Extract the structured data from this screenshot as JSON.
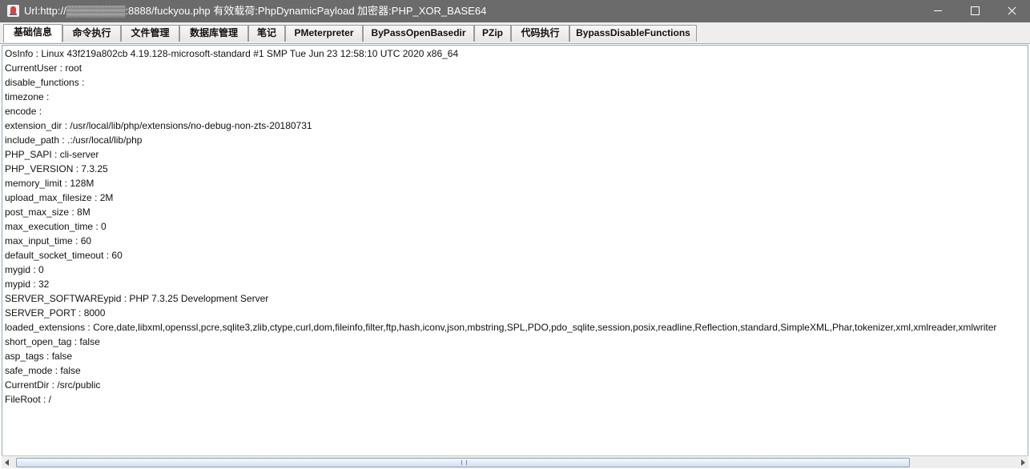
{
  "window": {
    "title": "Url:http://▒▒▒▒▒▒▒▒:8888/fuckyou.php 有效载荷:PhpDynamicPayload 加密器:PHP_XOR_BASE64",
    "icon": "java-app-icon"
  },
  "tabs": [
    {
      "label": "基础信息",
      "active": true
    },
    {
      "label": "命令执行"
    },
    {
      "label": "文件管理"
    },
    {
      "label": "数据库管理"
    },
    {
      "label": "笔记"
    },
    {
      "label": "PMeterpreter"
    },
    {
      "label": "ByPassOpenBasedir"
    },
    {
      "label": "PZip"
    },
    {
      "label": "代码执行"
    },
    {
      "label": "BypassDisableFunctions"
    }
  ],
  "info": {
    "lines": [
      "OsInfo : Linux 43f219a802cb 4.19.128-microsoft-standard #1 SMP Tue Jun 23 12:58:10 UTC 2020 x86_64",
      "CurrentUser : root",
      "disable_functions :",
      "timezone :",
      "encode :",
      "extension_dir : /usr/local/lib/php/extensions/no-debug-non-zts-20180731",
      "include_path : .:/usr/local/lib/php",
      "PHP_SAPI : cli-server",
      "PHP_VERSION : 7.3.25",
      "memory_limit : 128M",
      "upload_max_filesize : 2M",
      "post_max_size : 8M",
      "max_execution_time : 0",
      "max_input_time : 60",
      "default_socket_timeout : 60",
      "mygid : 0",
      "mypid : 32",
      "SERVER_SOFTWAREypid : PHP 7.3.25 Development Server",
      "SERVER_PORT : 8000",
      "loaded_extensions : Core,date,libxml,openssl,pcre,sqlite3,zlib,ctype,curl,dom,fileinfo,filter,ftp,hash,iconv,json,mbstring,SPL,PDO,pdo_sqlite,session,posix,readline,Reflection,standard,SimpleXML,Phar,tokenizer,xml,xmlreader,xmlwriter",
      "short_open_tag : false",
      "asp_tags : false",
      "safe_mode : false",
      "CurrentDir : /src/public",
      "FileRoot : /"
    ]
  }
}
